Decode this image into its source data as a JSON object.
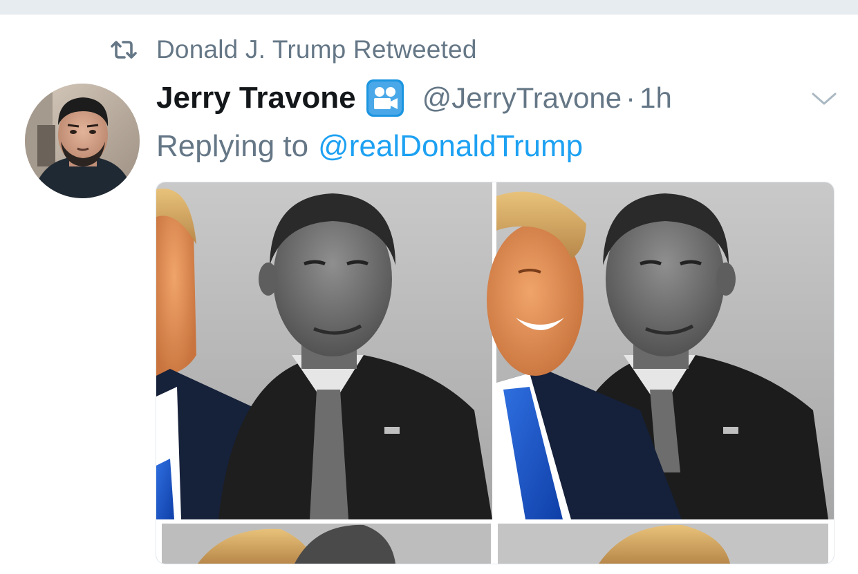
{
  "retweet": {
    "icon": "retweet-icon",
    "text": "Donald J. Trump Retweeted"
  },
  "tweet": {
    "display_name": "Jerry Travone",
    "badge_icon": "video-camera-icon",
    "handle": "@JerryTravone",
    "separator": "·",
    "time": "1h",
    "reply_prefix": "Replying to",
    "reply_handle": "@realDonaldTrump",
    "more_icon": "chevron-down-icon"
  },
  "colors": {
    "text_primary": "#14171a",
    "text_secondary": "#657786",
    "link": "#1da1f2",
    "badge": "#1b95e0"
  }
}
